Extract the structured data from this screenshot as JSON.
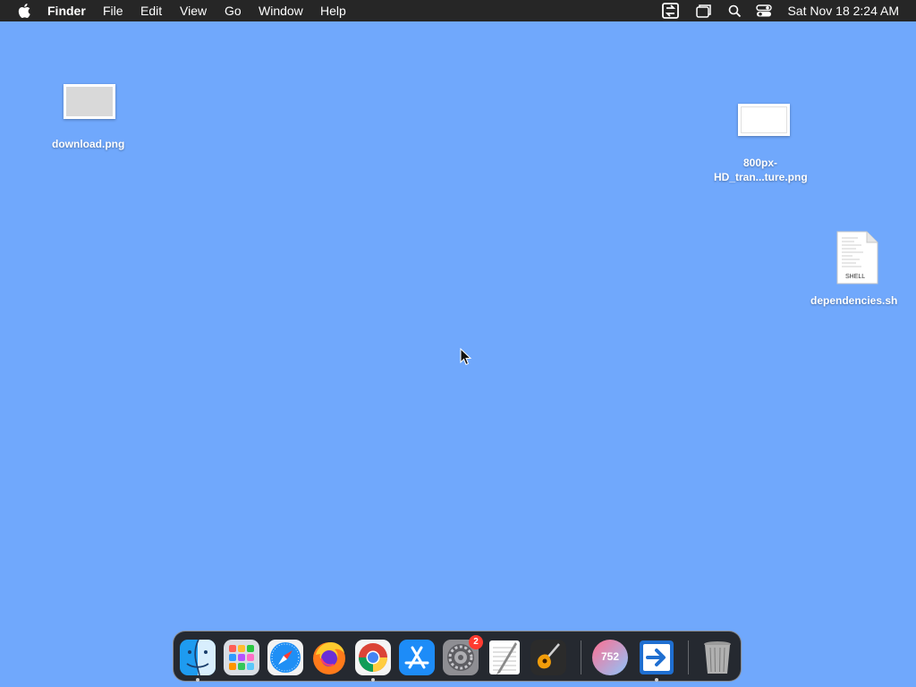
{
  "menubar": {
    "app_name": "Finder",
    "items": [
      "File",
      "Edit",
      "View",
      "Go",
      "Window",
      "Help"
    ],
    "clock": "Sat Nov 18  2:24 AM",
    "status_icons": [
      "screen-share-icon",
      "window-stack-icon",
      "spotlight-search-icon",
      "control-center-icon"
    ]
  },
  "desktop": {
    "files": [
      {
        "name": "download.png",
        "icon": "image-thumbnail-icon"
      },
      {
        "name_line1": "800px-",
        "name_line2": "HD_tran...ture.png",
        "icon": "image-thumbnail-icon"
      },
      {
        "name": "dependencies.sh",
        "icon": "shell-script-icon",
        "doc_label": "SHELL"
      }
    ]
  },
  "dock": {
    "apps": [
      {
        "name": "Finder",
        "icon": "finder-icon",
        "running": true
      },
      {
        "name": "Launchpad",
        "icon": "launchpad-icon",
        "running": false
      },
      {
        "name": "Safari",
        "icon": "safari-icon",
        "running": false
      },
      {
        "name": "Firefox",
        "icon": "firefox-icon",
        "running": false
      },
      {
        "name": "Chrome",
        "icon": "chrome-icon",
        "running": true
      },
      {
        "name": "App Store",
        "icon": "app-store-icon",
        "running": false
      },
      {
        "name": "System Settings",
        "icon": "settings-gear-icon",
        "running": false,
        "badge": "2"
      },
      {
        "name": "TextEdit",
        "icon": "textedit-icon",
        "running": false
      },
      {
        "name": "GarageBand",
        "icon": "guitar-icon",
        "running": false
      },
      {
        "name": "Counter",
        "icon": "counter-icon",
        "running": false,
        "label": "752"
      },
      {
        "name": "Migration",
        "icon": "migration-arrow-icon",
        "running": true
      },
      {
        "name": "Trash",
        "icon": "trash-icon",
        "running": false
      }
    ]
  },
  "colors": {
    "desktop": "#70a8fc",
    "menubar": "#262626",
    "badge": "#ff3b30"
  }
}
